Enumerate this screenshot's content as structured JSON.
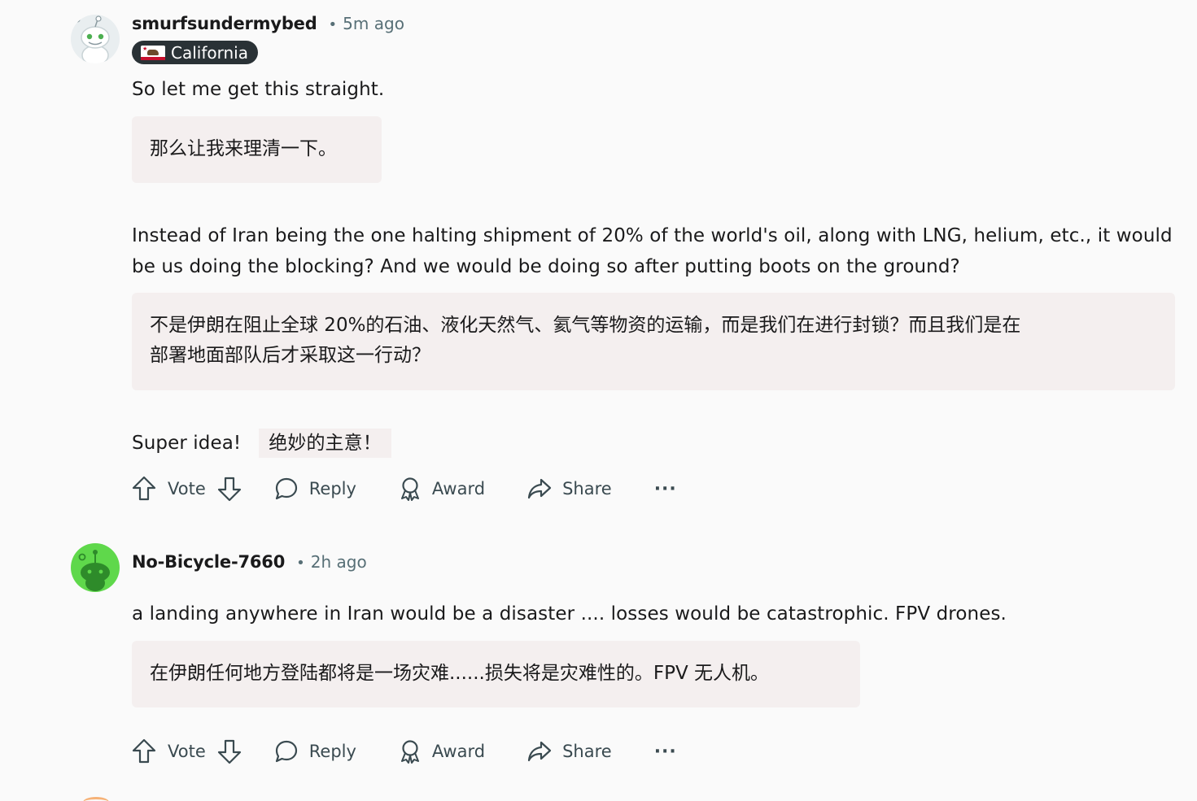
{
  "comments": [
    {
      "username": "smurfsundermybed",
      "time": "5m ago",
      "flair": "California",
      "body": [
        "So let me get this straight.",
        "Instead of Iran being the one halting shipment of 20% of the world's oil, along with LNG, helium, etc., it would",
        "be us doing the blocking? And we would be doing so after putting boots on the ground?",
        "Super idea!"
      ],
      "translations": [
        "那么让我来理清一下。",
        "不是伊朗在阻止全球 20%的石油、液化天然气、氦气等物资的运输，而是我们在进行封锁？而且我们是在",
        "部署地面部队后才采取这一行动？",
        "绝妙的主意！"
      ],
      "actions": {
        "vote": "Vote",
        "reply": "Reply",
        "award": "Award",
        "share": "Share",
        "more": "···"
      }
    },
    {
      "username": "No-Bicycle-7660",
      "time": "2h ago",
      "body": [
        "a landing anywhere in Iran would be a disaster .... losses would be catastrophic. FPV drones."
      ],
      "translations": [
        "在伊朗任何地方登陆都将是一场灾难......损失将是灾难性的。FPV 无人机。"
      ],
      "actions": {
        "vote": "Vote",
        "reply": "Reply",
        "award": "Award",
        "share": "Share",
        "more": "···"
      }
    }
  ],
  "colors": {
    "background": "#fafafa",
    "translation_bg": "#f4efef",
    "flair_bg": "#2a3236",
    "meta_text": "#576f76",
    "avatar_green": "#5fd84b"
  },
  "icons": [
    "upvote-icon",
    "downvote-icon",
    "reply-icon",
    "award-icon",
    "share-icon",
    "more-icon"
  ]
}
